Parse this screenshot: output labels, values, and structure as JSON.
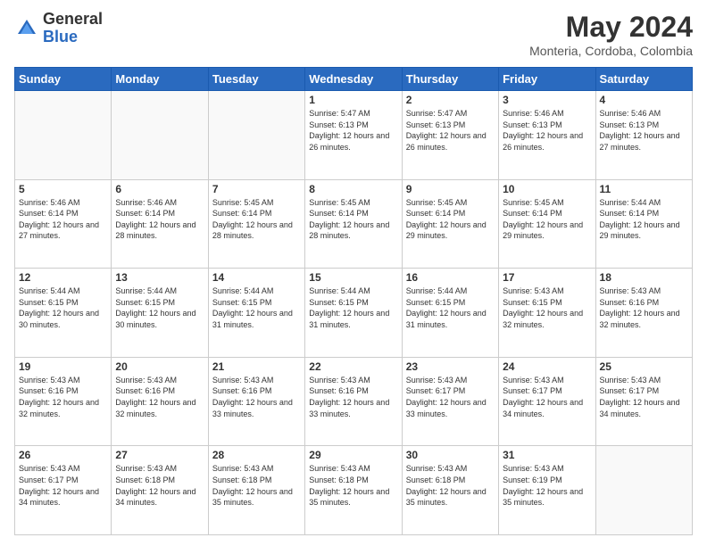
{
  "logo": {
    "general": "General",
    "blue": "Blue"
  },
  "header": {
    "month_year": "May 2024",
    "location": "Monteria, Cordoba, Colombia"
  },
  "weekdays": [
    "Sunday",
    "Monday",
    "Tuesday",
    "Wednesday",
    "Thursday",
    "Friday",
    "Saturday"
  ],
  "weeks": [
    [
      {
        "day": "",
        "info": ""
      },
      {
        "day": "",
        "info": ""
      },
      {
        "day": "",
        "info": ""
      },
      {
        "day": "1",
        "info": "Sunrise: 5:47 AM\nSunset: 6:13 PM\nDaylight: 12 hours\nand 26 minutes."
      },
      {
        "day": "2",
        "info": "Sunrise: 5:47 AM\nSunset: 6:13 PM\nDaylight: 12 hours\nand 26 minutes."
      },
      {
        "day": "3",
        "info": "Sunrise: 5:46 AM\nSunset: 6:13 PM\nDaylight: 12 hours\nand 26 minutes."
      },
      {
        "day": "4",
        "info": "Sunrise: 5:46 AM\nSunset: 6:13 PM\nDaylight: 12 hours\nand 27 minutes."
      }
    ],
    [
      {
        "day": "5",
        "info": "Sunrise: 5:46 AM\nSunset: 6:14 PM\nDaylight: 12 hours\nand 27 minutes."
      },
      {
        "day": "6",
        "info": "Sunrise: 5:46 AM\nSunset: 6:14 PM\nDaylight: 12 hours\nand 28 minutes."
      },
      {
        "day": "7",
        "info": "Sunrise: 5:45 AM\nSunset: 6:14 PM\nDaylight: 12 hours\nand 28 minutes."
      },
      {
        "day": "8",
        "info": "Sunrise: 5:45 AM\nSunset: 6:14 PM\nDaylight: 12 hours\nand 28 minutes."
      },
      {
        "day": "9",
        "info": "Sunrise: 5:45 AM\nSunset: 6:14 PM\nDaylight: 12 hours\nand 29 minutes."
      },
      {
        "day": "10",
        "info": "Sunrise: 5:45 AM\nSunset: 6:14 PM\nDaylight: 12 hours\nand 29 minutes."
      },
      {
        "day": "11",
        "info": "Sunrise: 5:44 AM\nSunset: 6:14 PM\nDaylight: 12 hours\nand 29 minutes."
      }
    ],
    [
      {
        "day": "12",
        "info": "Sunrise: 5:44 AM\nSunset: 6:15 PM\nDaylight: 12 hours\nand 30 minutes."
      },
      {
        "day": "13",
        "info": "Sunrise: 5:44 AM\nSunset: 6:15 PM\nDaylight: 12 hours\nand 30 minutes."
      },
      {
        "day": "14",
        "info": "Sunrise: 5:44 AM\nSunset: 6:15 PM\nDaylight: 12 hours\nand 31 minutes."
      },
      {
        "day": "15",
        "info": "Sunrise: 5:44 AM\nSunset: 6:15 PM\nDaylight: 12 hours\nand 31 minutes."
      },
      {
        "day": "16",
        "info": "Sunrise: 5:44 AM\nSunset: 6:15 PM\nDaylight: 12 hours\nand 31 minutes."
      },
      {
        "day": "17",
        "info": "Sunrise: 5:43 AM\nSunset: 6:15 PM\nDaylight: 12 hours\nand 32 minutes."
      },
      {
        "day": "18",
        "info": "Sunrise: 5:43 AM\nSunset: 6:16 PM\nDaylight: 12 hours\nand 32 minutes."
      }
    ],
    [
      {
        "day": "19",
        "info": "Sunrise: 5:43 AM\nSunset: 6:16 PM\nDaylight: 12 hours\nand 32 minutes."
      },
      {
        "day": "20",
        "info": "Sunrise: 5:43 AM\nSunset: 6:16 PM\nDaylight: 12 hours\nand 32 minutes."
      },
      {
        "day": "21",
        "info": "Sunrise: 5:43 AM\nSunset: 6:16 PM\nDaylight: 12 hours\nand 33 minutes."
      },
      {
        "day": "22",
        "info": "Sunrise: 5:43 AM\nSunset: 6:16 PM\nDaylight: 12 hours\nand 33 minutes."
      },
      {
        "day": "23",
        "info": "Sunrise: 5:43 AM\nSunset: 6:17 PM\nDaylight: 12 hours\nand 33 minutes."
      },
      {
        "day": "24",
        "info": "Sunrise: 5:43 AM\nSunset: 6:17 PM\nDaylight: 12 hours\nand 34 minutes."
      },
      {
        "day": "25",
        "info": "Sunrise: 5:43 AM\nSunset: 6:17 PM\nDaylight: 12 hours\nand 34 minutes."
      }
    ],
    [
      {
        "day": "26",
        "info": "Sunrise: 5:43 AM\nSunset: 6:17 PM\nDaylight: 12 hours\nand 34 minutes."
      },
      {
        "day": "27",
        "info": "Sunrise: 5:43 AM\nSunset: 6:18 PM\nDaylight: 12 hours\nand 34 minutes."
      },
      {
        "day": "28",
        "info": "Sunrise: 5:43 AM\nSunset: 6:18 PM\nDaylight: 12 hours\nand 35 minutes."
      },
      {
        "day": "29",
        "info": "Sunrise: 5:43 AM\nSunset: 6:18 PM\nDaylight: 12 hours\nand 35 minutes."
      },
      {
        "day": "30",
        "info": "Sunrise: 5:43 AM\nSunset: 6:18 PM\nDaylight: 12 hours\nand 35 minutes."
      },
      {
        "day": "31",
        "info": "Sunrise: 5:43 AM\nSunset: 6:19 PM\nDaylight: 12 hours\nand 35 minutes."
      },
      {
        "day": "",
        "info": ""
      }
    ]
  ]
}
